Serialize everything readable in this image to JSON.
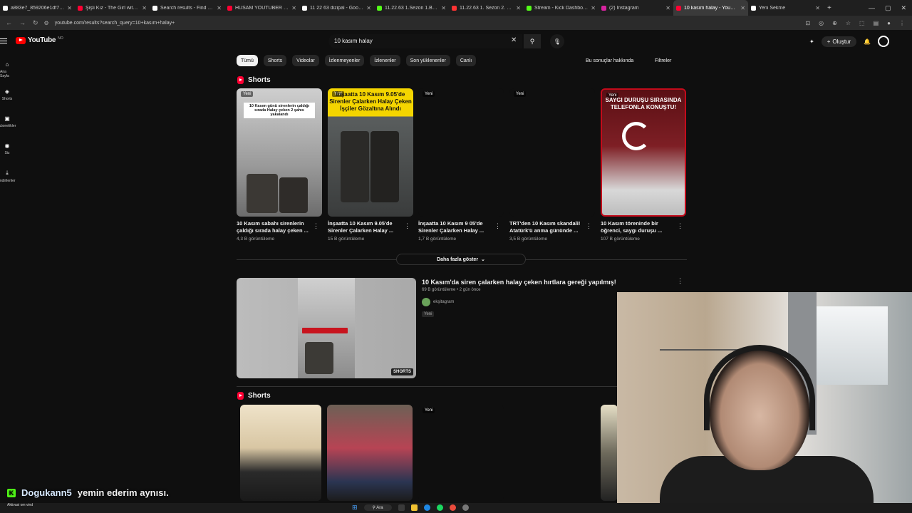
{
  "browser": {
    "tabs": [
      {
        "title": "a883e7_859206e1df7640...",
        "color": "#ffffff",
        "active": false
      },
      {
        "title": "Şişli Kız - The Girl with the...",
        "color": "#ff0033",
        "active": false
      },
      {
        "title": "Search results - Find Case...",
        "color": "#ffffff",
        "active": false
      },
      {
        "title": "HUSAM YOUTUBER TER...",
        "color": "#ff0033",
        "active": false
      },
      {
        "title": "11 22 63 dizipal - Google",
        "color": "#ffffff",
        "active": false
      },
      {
        "title": "11.22.63 1.Sezon 1.Bölüm",
        "color": "#53fc18",
        "active": false
      },
      {
        "title": "11.22.63 1. Sezon 2. Bölüm",
        "color": "#ff3333",
        "active": false
      },
      {
        "title": "Stream - Kick Dashboard",
        "color": "#53fc18",
        "active": false
      },
      {
        "title": "(2) Instagram",
        "color": "#d6249f",
        "active": false
      },
      {
        "title": "10 kasım halay - YouTube",
        "color": "#ff0033",
        "active": true
      },
      {
        "title": "Yeni Sekme",
        "color": "#ffffff",
        "active": false
      }
    ],
    "url": "youtube.com/results?search_query=10+kasım+halay+"
  },
  "header": {
    "logo_text": "YouTube",
    "country_code": "NO",
    "search_query": "10 kasım halay",
    "create_label": "Oluştur"
  },
  "guide": [
    {
      "icon": "⌂",
      "label": "Ana Sayfa"
    },
    {
      "icon": "◈",
      "label": "Shorts"
    },
    {
      "icon": "▣",
      "label": "Abonelikler"
    },
    {
      "icon": "◉",
      "label": "Siz"
    },
    {
      "icon": "⤓",
      "label": "İndirilenler"
    }
  ],
  "filters": {
    "chips": [
      "Tümü",
      "Shorts",
      "Videolar",
      "İzlenmeyenler",
      "İzlenenler",
      "Son yüklenenler",
      "Canlı"
    ],
    "about_label": "Bu sonuçlar hakkında",
    "filters_label": "Filtreler"
  },
  "shorts_section_1": {
    "title": "Shorts",
    "items": [
      {
        "badge": "Yeni",
        "overlay": "10 Kasım günü sirenlerin çaldığı sırada Halay çeken 2 şahıs yakalandı",
        "title": "10 Kasım sabahı sirenlerin çaldığı sırada halay çeken ...",
        "views": "4,3 B görüntüleme"
      },
      {
        "badge": "Yeni",
        "overlay": "İnşaatta 10 Kasım 9.05'de Sirenler Çalarken Halay Çeken İşçiler Gözaltına Alındı",
        "title": "İnşaatta 10 Kasım 9.05'de Sirenler Çalarken Halay ...",
        "views": "15 B görüntüleme"
      },
      {
        "badge": "Yeni",
        "overlay": "",
        "title": "İnşaatta 10 Kasım 9 05'de Sirenler Çalarken Halay ...",
        "views": "1,7 B görüntüleme"
      },
      {
        "badge": "Yeni",
        "overlay": "",
        "title": "TRT'den 10 Kasım skandali! Atatürk'ü anma gününde ...",
        "views": "3,5 B görüntüleme"
      },
      {
        "badge": "Yeni",
        "overlay": "SAYGI DURUŞU SIRASINDA TELEFONLA KONUŞTU!",
        "title": "10 Kasım töreninde bir öğrenci, saygı duruşu ...",
        "views": "107 B görüntüleme"
      }
    ],
    "show_more_label": "Daha fazla göster"
  },
  "video_result": {
    "title": "10 Kasım'da siren çalarken halay çeken hırtlara gereği yapılmış!",
    "meta": "69 B görüntüleme • 2 gün önce",
    "channel": "ekşitagram",
    "badge": "Yeni",
    "thumb_badge": "SHORTS"
  },
  "shorts_section_2": {
    "title": "Shorts",
    "items": [
      {
        "badge": ""
      },
      {
        "badge": ""
      },
      {
        "badge": "Yeni"
      }
    ]
  },
  "chat": {
    "username": "Dogukann5",
    "message": "yemin ederim aynısı."
  },
  "taskbar": {
    "note_line1": "Aktivasi om vind",
    "search_label": "Ara"
  }
}
